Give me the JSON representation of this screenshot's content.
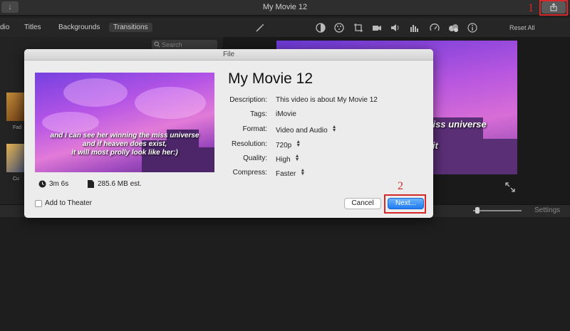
{
  "window": {
    "title": "My Movie 12"
  },
  "annotations": {
    "one": "1",
    "two": "2"
  },
  "toolbar": {
    "tabs": [
      {
        "label": "dio"
      },
      {
        "label": "Titles"
      },
      {
        "label": "Backgrounds"
      },
      {
        "label": "Transitions"
      }
    ],
    "reset_all": "Reset All"
  },
  "browser": {
    "search_placeholder": "Search",
    "thumb_captions": [
      "Fad",
      "Cu"
    ]
  },
  "viewer": {
    "caption": [
      "miss universe",
      ",",
      "e it"
    ]
  },
  "timeline": {
    "settings_label": "Settings"
  },
  "dialog": {
    "title": "File",
    "movie_title": "My Movie 12",
    "preview_caption": [
      "and i can see her winning the miss universe",
      "and if heaven does exist,",
      "it will most prolly look like her:)"
    ],
    "duration": "3m 6s",
    "size": "285.6 MB est.",
    "fields": [
      {
        "label": "Description:",
        "value": "This video is about My Movie 12"
      },
      {
        "label": "Tags:",
        "value": "iMovie"
      },
      {
        "label": "Format:",
        "value": "Video and Audio"
      },
      {
        "label": "Resolution:",
        "value": "720p"
      },
      {
        "label": "Quality:",
        "value": "High"
      },
      {
        "label": "Compress:",
        "value": "Faster"
      }
    ],
    "add_to_theater": "Add to Theater",
    "cancel_label": "Cancel",
    "next_label": "Next..."
  },
  "colors": {
    "annotation": "#d62828",
    "primary_button": "#1f7bf2"
  }
}
